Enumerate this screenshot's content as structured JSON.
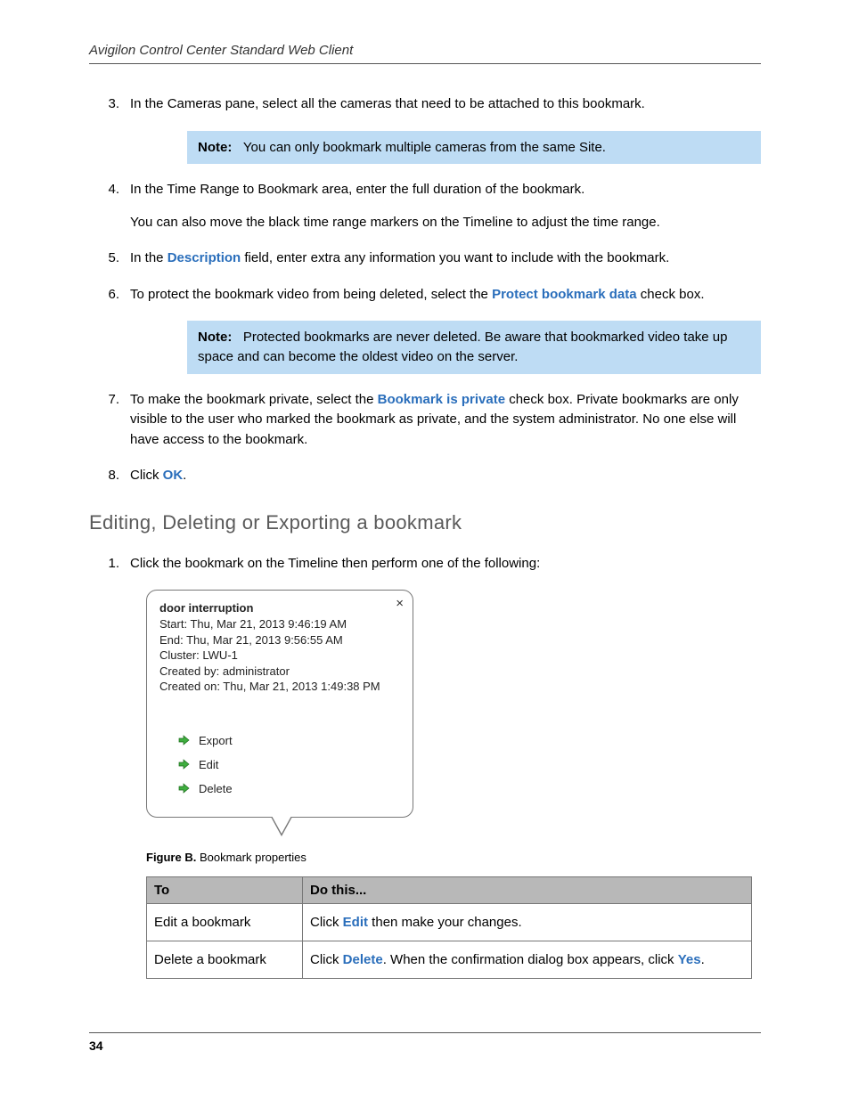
{
  "header": {
    "title": "Avigilon Control Center Standard Web Client"
  },
  "steps": {
    "s3": {
      "num": "3.",
      "text": "In the Cameras pane, select all the cameras that need to be attached to this bookmark."
    },
    "note1": {
      "label": "Note:",
      "text": "You can only bookmark multiple cameras from the same Site."
    },
    "s4": {
      "num": "4.",
      "p1": "In the Time Range to Bookmark area, enter the full duration of the bookmark.",
      "p2": "You can also move the black time range markers on the Timeline to adjust the time range."
    },
    "s5": {
      "num": "5.",
      "pre": "In the ",
      "link": "Description",
      "post": " field, enter extra any information you want to include with the bookmark."
    },
    "s6": {
      "num": "6.",
      "pre": "To protect the bookmark video from being deleted, select the ",
      "link": "Protect bookmark data",
      "post": " check box."
    },
    "note2": {
      "label": "Note:",
      "text": "Protected bookmarks are never deleted. Be aware that bookmarked video take up space and can become the oldest video on the server."
    },
    "s7": {
      "num": "7.",
      "pre": "To make the bookmark private, select the ",
      "link": "Bookmark is private",
      "post": " check box. Private bookmarks are only visible to the user who marked the bookmark as private, and the system administrator. No one else will have access to the bookmark."
    },
    "s8": {
      "num": "8.",
      "pre": "Click ",
      "link": "OK",
      "post": "."
    }
  },
  "section": {
    "heading": "Editing, Deleting or Exporting a bookmark",
    "step1": {
      "num": "1.",
      "text": "Click the bookmark on the Timeline then perform one of the following:"
    }
  },
  "popup": {
    "title": "door interruption",
    "start": "Start: Thu, Mar 21, 2013 9:46:19 AM",
    "end": "End: Thu, Mar 21, 2013 9:56:55 AM",
    "cluster": "Cluster: LWU-1",
    "created_by": "Created by: administrator",
    "created_on": "Created on: Thu, Mar 21, 2013 1:49:38 PM",
    "close": "×",
    "actions": {
      "export": "Export",
      "edit": "Edit",
      "delete": "Delete"
    }
  },
  "figure": {
    "label": "Figure B.",
    "caption": "Bookmark properties"
  },
  "table": {
    "h1": "To",
    "h2": "Do this...",
    "r1": {
      "to": "Edit a bookmark",
      "pre": "Click ",
      "link": "Edit",
      "post": " then make your changes."
    },
    "r2": {
      "to": "Delete a bookmark",
      "pre": "Click ",
      "link": "Delete",
      "mid": ". When the confirmation dialog box appears, click ",
      "link2": "Yes",
      "post": "."
    }
  },
  "page_number": "34"
}
